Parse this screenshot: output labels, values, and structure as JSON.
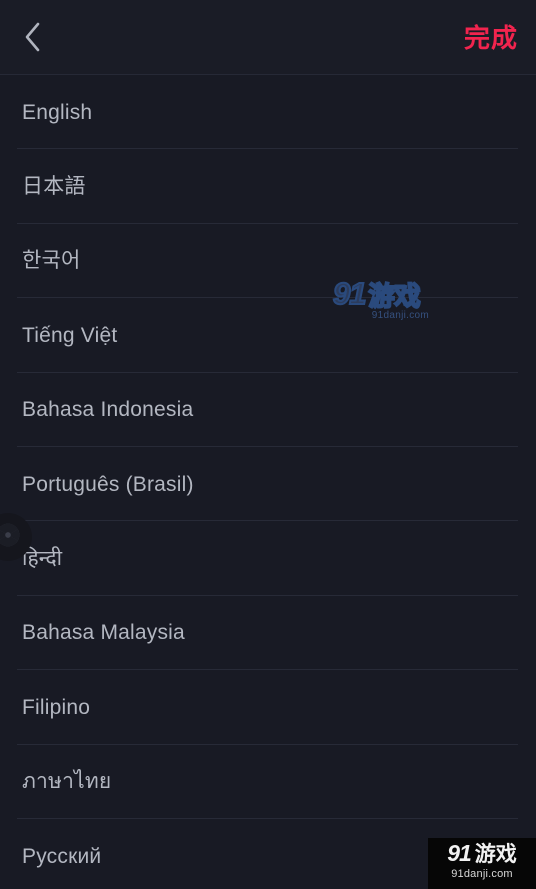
{
  "colors": {
    "background": "#181a24",
    "header_background": "#1a1c26",
    "divider": "#272a37",
    "text_primary": "#b3b7c1",
    "accent_done": "#f2244e",
    "watermark_center": "#2a4a7d",
    "watermark_corner_bg": "#060606"
  },
  "header": {
    "back_icon": "chevron-left-icon",
    "done_label": "完成"
  },
  "language_list": {
    "items": [
      {
        "label": "English"
      },
      {
        "label": "日本語"
      },
      {
        "label": "한국어"
      },
      {
        "label": "Tiếng Việt"
      },
      {
        "label": "Bahasa Indonesia"
      },
      {
        "label": "Português (Brasil)"
      },
      {
        "label": "हिन्दी"
      },
      {
        "label": "Bahasa Malaysia"
      },
      {
        "label": "Filipino"
      },
      {
        "label": "ภาษาไทย"
      },
      {
        "label": "Русский"
      }
    ]
  },
  "floating_widget": {
    "icon": "camera-aperture-icon"
  },
  "watermark_center": {
    "number": "91",
    "word": "游戏",
    "url": "91danji.com"
  },
  "watermark_corner": {
    "number": "91",
    "word": "游戏",
    "url": "91danji.com"
  }
}
